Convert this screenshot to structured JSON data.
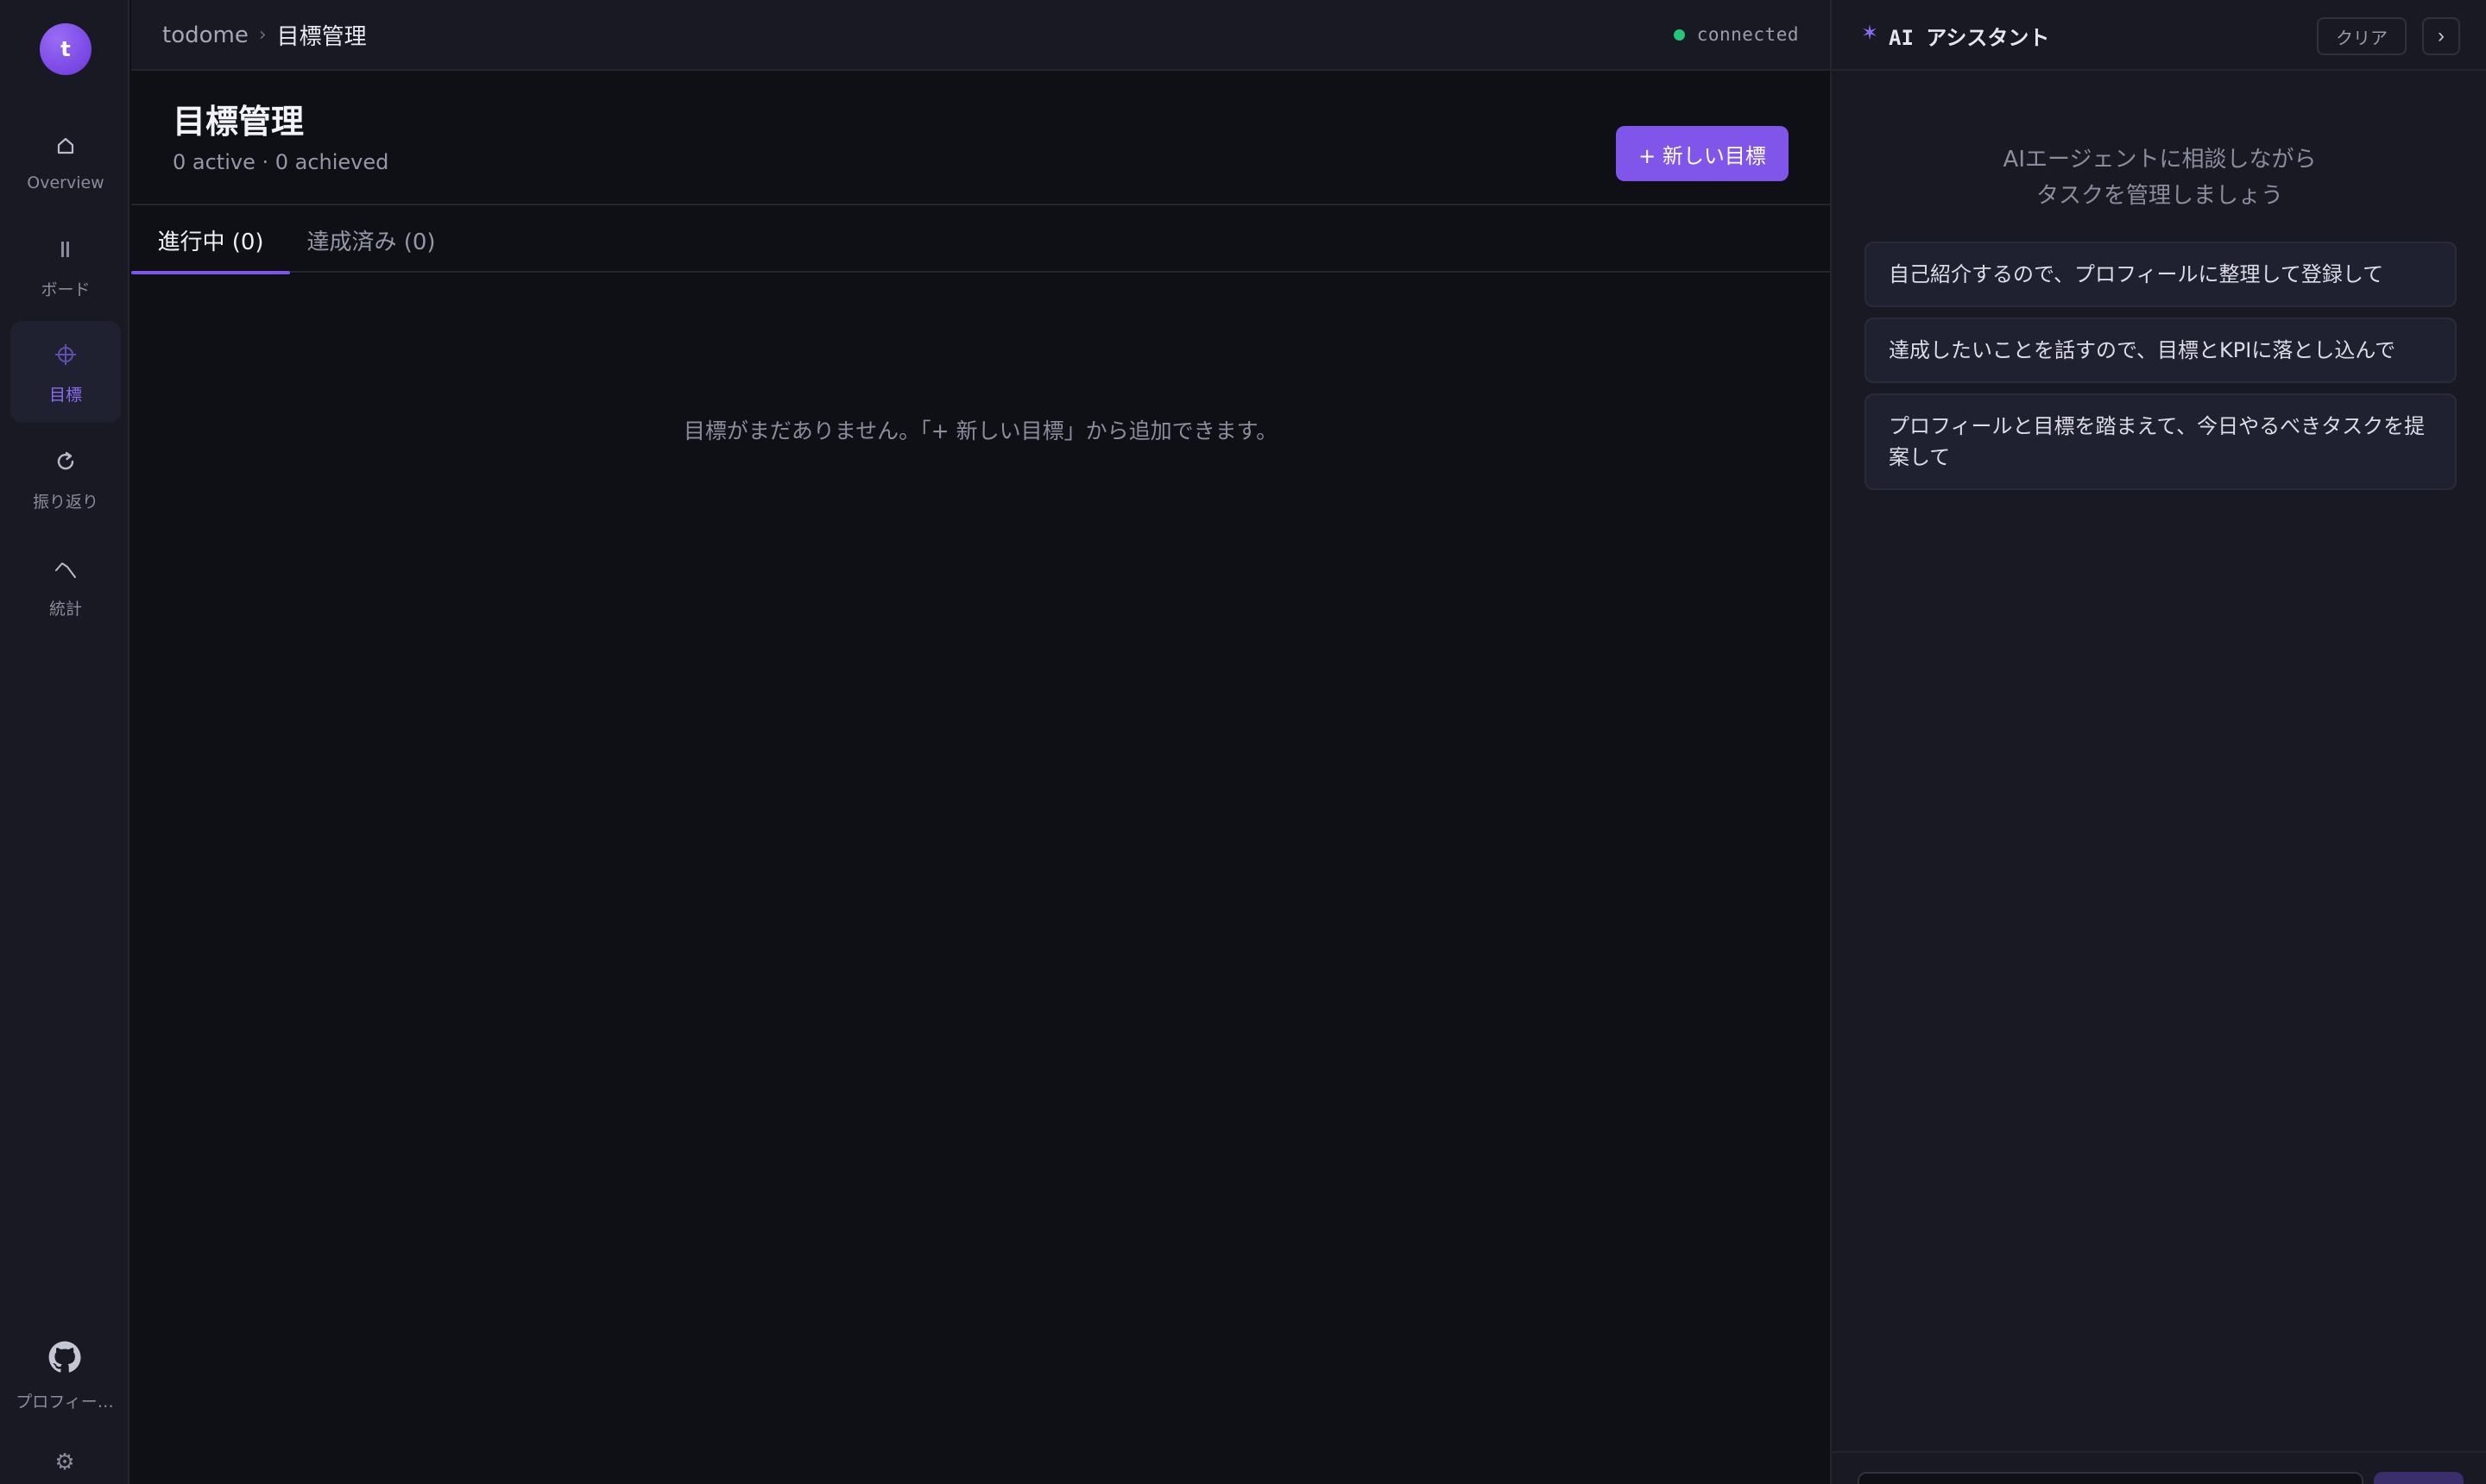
{
  "rail": {
    "avatar_letter": "t",
    "items": [
      {
        "label": "Overview",
        "icon": "home-icon"
      },
      {
        "label": "ボード",
        "icon": "board-icon"
      },
      {
        "label": "目標",
        "icon": "target-icon"
      },
      {
        "label": "振り返り",
        "icon": "refresh-icon"
      },
      {
        "label": "統計",
        "icon": "stats-icon"
      }
    ],
    "profile_label": "プロフィー…",
    "profile_icon": "github-icon",
    "settings_icon": "gear-icon"
  },
  "topbar": {
    "breadcrumb_root": "todome",
    "breadcrumb_sep": "›",
    "breadcrumb_current": "目標管理",
    "status": "connected",
    "status_color": "#22c57a"
  },
  "page": {
    "title": "目標管理",
    "subtitle": "0 active · 0 achieved",
    "new_goal_button": "+ 新しい目標",
    "tabs": [
      "進行中 (0)",
      "達成済み (0)"
    ],
    "empty_message": "目標がまだありません。「+ 新しい目標」から追加できます。"
  },
  "ai": {
    "spark": "✶",
    "title": "AI アシスタント",
    "clear_button": "クリア",
    "collapse_glyph": "›",
    "intro_line1": "AIエージェントに相談しながら",
    "intro_line2": "タスクを管理しましょう",
    "suggestions": [
      "自己紹介するので、プロフィールに整理して登録して",
      "達成したいことを話すので、目標とKPIに落とし込んで",
      "プロフィールと目標を踏まえて、今日やるべきタスクを提案して"
    ]
  },
  "colors": {
    "accent": "#8055ea",
    "background": "#0f1016",
    "panel": "#181922"
  }
}
